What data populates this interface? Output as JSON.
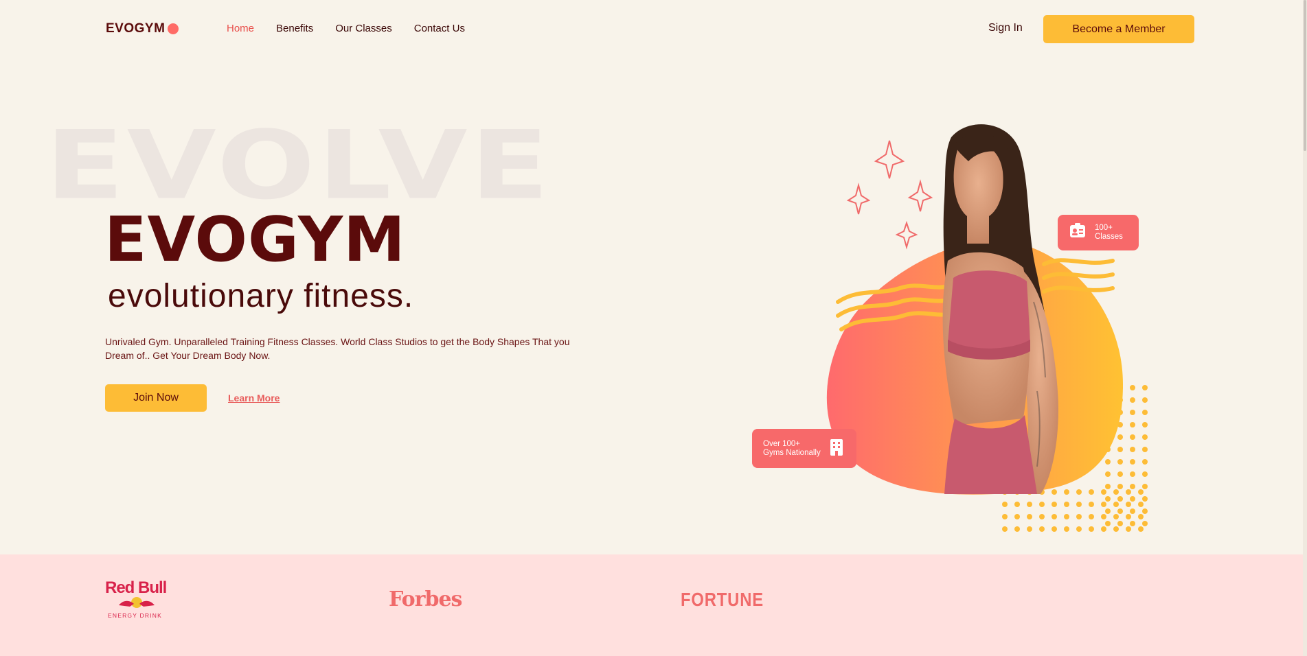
{
  "nav": {
    "logo": "EVOGYM",
    "links": [
      "Home",
      "Benefits",
      "Our Classes",
      "Contact Us"
    ],
    "active": "Home",
    "sign_in": "Sign In",
    "member_button": "Become a Member"
  },
  "hero": {
    "background_word": "EVOLVE",
    "title": "EVOGYM",
    "subtitle": "evolutionary fitness.",
    "description": "Unrivaled Gym. Unparalleled Training Fitness Classes. World Class Studios to get the Body Shapes That you Dream of.. Get Your Dream Body Now.",
    "join_button": "Join Now",
    "learn_more": "Learn More",
    "badge_classes": {
      "line1": "100+",
      "line2": "Classes",
      "icon": "id-card-icon"
    },
    "badge_gyms": {
      "line1": "Over 100+",
      "line2": "Gyms Nationally",
      "icon": "building-icon"
    }
  },
  "partners": {
    "redbull": {
      "name": "Red Bull",
      "sub": "ENERGY DRINK"
    },
    "forbes": "Forbes",
    "fortune": "FORTUNE"
  },
  "colors": {
    "background": "#f8f3ea",
    "primary_dark": "#5b0b0b",
    "accent_red": "#ff6b66",
    "accent_yellow": "#fdbc36",
    "partners_bg": "#ffe0de"
  }
}
